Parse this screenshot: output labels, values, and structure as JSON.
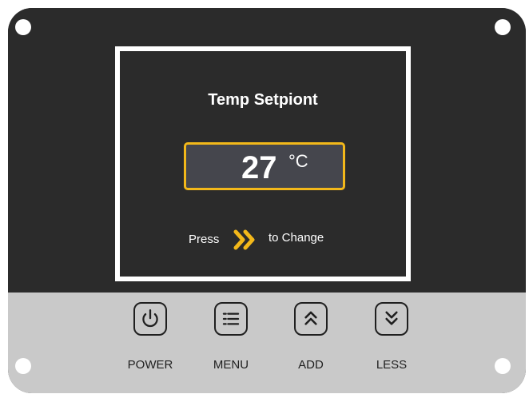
{
  "screen": {
    "title": "Temp Setpiont",
    "temperature": {
      "value": "27",
      "unit": "°C"
    },
    "hint": {
      "prefix": "Press",
      "arrow_icon": "double-chevron-right-icon",
      "suffix": "to Change"
    }
  },
  "buttons": [
    {
      "label": "POWER",
      "icon": "power-icon"
    },
    {
      "label": "MENU",
      "icon": "menu-list-icon"
    },
    {
      "label": "ADD",
      "icon": "double-chevron-up-icon"
    },
    {
      "label": "LESS",
      "icon": "double-chevron-down-icon"
    }
  ],
  "colors": {
    "panel_dark": "#2b2b2b",
    "panel_light": "#c9c9c9",
    "accent": "#f3b81a",
    "display_field": "#45464d",
    "screen_border": "#ffffff"
  }
}
